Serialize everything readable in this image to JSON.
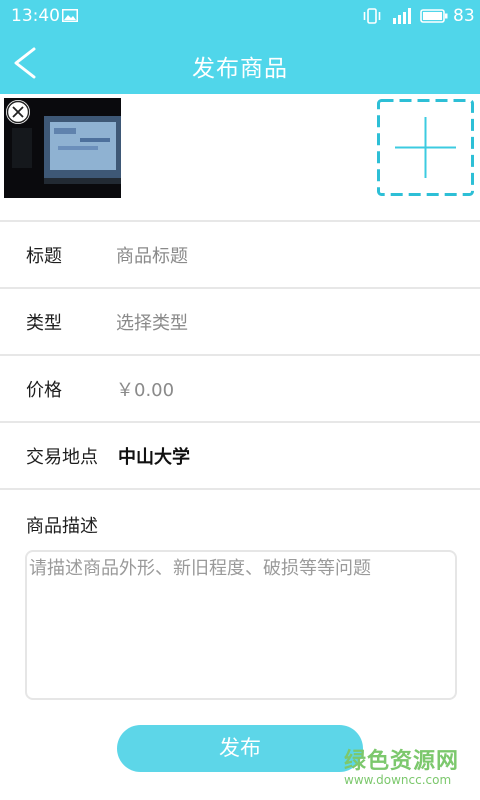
{
  "status": {
    "time": "13:40",
    "battery": "83"
  },
  "header": {
    "title": "发布商品"
  },
  "form": {
    "title_label": "标题",
    "title_placeholder": "商品标题",
    "type_label": "类型",
    "type_placeholder": "选择类型",
    "price_label": "价格",
    "price_value": "￥0.00",
    "location_label": "交易地点",
    "location_value": "中山大学",
    "desc_label": "商品描述",
    "desc_placeholder": "请描述商品外形、新旧程度、破损等等问题"
  },
  "actions": {
    "publish": "发布"
  },
  "watermark": {
    "name": "绿色资源网",
    "url": "www.downcc.com"
  },
  "colors": {
    "accent": "#50d6ea",
    "button": "#5dd6e8",
    "add_border": "#2dbfd6"
  }
}
